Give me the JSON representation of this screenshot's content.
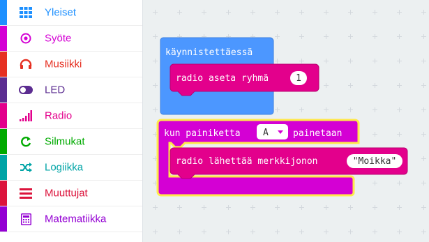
{
  "toolbox": {
    "categories": [
      {
        "label": "Yleiset",
        "color": "#1e90ff",
        "icon": "grid-icon"
      },
      {
        "label": "Syöte",
        "color": "#d400d4",
        "icon": "target-icon"
      },
      {
        "label": "Musiikki",
        "color": "#e63022",
        "icon": "headphones-icon"
      },
      {
        "label": "LED",
        "color": "#5c2d91",
        "icon": "toggle-icon"
      },
      {
        "label": "Radio",
        "color": "#e3008c",
        "icon": "signal-bars-icon"
      },
      {
        "label": "Silmukat",
        "color": "#00aa00",
        "icon": "loop-icon"
      },
      {
        "label": "Logiikka",
        "color": "#00a4a6",
        "icon": "shuffle-icon"
      },
      {
        "label": "Muuttujat",
        "color": "#dc143c",
        "icon": "list-icon"
      },
      {
        "label": "Matematiikka",
        "color": "#9400d3",
        "icon": "calculator-icon"
      }
    ]
  },
  "workspace": {
    "start_block": {
      "label": "käynnistettäessä",
      "color": "#4c97ff",
      "inner": {
        "label": "radio aseta ryhmä",
        "value": "1",
        "color": "#e3008c"
      }
    },
    "button_block": {
      "label_before": "kun painiketta",
      "button_value": "A",
      "label_after": "painetaan",
      "color": "#d400d4",
      "inner": {
        "label": "radio lähettää merkkijonon",
        "value": "\"Moikka\"",
        "color": "#e3008c"
      }
    }
  }
}
